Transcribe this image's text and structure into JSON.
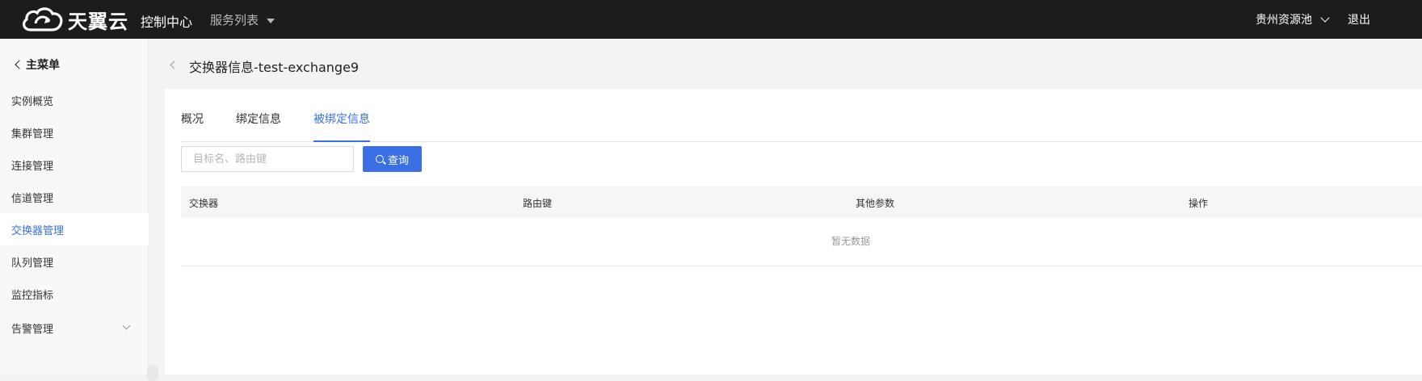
{
  "header": {
    "logo_text": "天翼云",
    "console": "控制中心",
    "services": "服务列表",
    "region": "贵州资源池",
    "logout": "退出"
  },
  "sidebar": {
    "back_label": "主菜单",
    "items": [
      {
        "label": "实例概览",
        "active": false
      },
      {
        "label": "集群管理",
        "active": false
      },
      {
        "label": "连接管理",
        "active": false
      },
      {
        "label": "信道管理",
        "active": false
      },
      {
        "label": "交换器管理",
        "active": true
      },
      {
        "label": "队列管理",
        "active": false
      },
      {
        "label": "监控指标",
        "active": false
      },
      {
        "label": "告警管理",
        "active": false,
        "expandable": true
      }
    ]
  },
  "page": {
    "title": "交换器信息-test-exchange9"
  },
  "tabs": [
    {
      "label": "概况",
      "active": false
    },
    {
      "label": "绑定信息",
      "active": false
    },
    {
      "label": "被绑定信息",
      "active": true
    }
  ],
  "search": {
    "placeholder": "目标名、路由键",
    "value": "",
    "button_label": "查询"
  },
  "table": {
    "columns": [
      "交换器",
      "路由键",
      "其他参数",
      "操作"
    ],
    "rows": [],
    "empty_text": "暂无数据"
  },
  "colors": {
    "topbar": "#1c1c1e",
    "accent": "#3a6fe6",
    "background": "#f2f3f5"
  }
}
